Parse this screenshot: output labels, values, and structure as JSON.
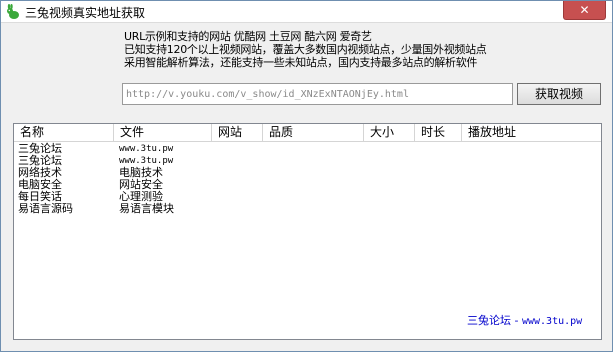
{
  "window": {
    "title": "三兔视频真实地址获取",
    "close_label": "✕",
    "app_icon": "rabbit-icon"
  },
  "intro": {
    "line1": "URL示例和支持的网站 优酷网 土豆网 酷六网 爱奇艺",
    "line2": "已知支持120个以上视频网站，覆盖大多数国内视频站点，少量国外视频站点",
    "line3": "采用智能解析算法，还能支持一些未知站点，国内支持最多站点的解析软件"
  },
  "url_input": {
    "placeholder": "http://v.youku.com/v_show/id_XNzExNTAONjEy.html",
    "value": ""
  },
  "fetch_button": {
    "label": "获取视频"
  },
  "list": {
    "columns": [
      "名称",
      "文件",
      "网站",
      "品质",
      "大小",
      "时长",
      "播放地址"
    ],
    "rows": [
      {
        "name": "三兔论坛",
        "file": "www.3tu.pw"
      },
      {
        "name": "三兔论坛",
        "file": "www.3tu.pw"
      },
      {
        "name": "网络技术",
        "file": "电脑技术"
      },
      {
        "name": "电脑安全",
        "file": "网站安全"
      },
      {
        "name": "每日笑话",
        "file": "心理测验"
      },
      {
        "name": "易语言源码",
        "file": "易语言模块"
      }
    ]
  },
  "footer": {
    "link_name": "三兔论坛",
    "link_sep": " - ",
    "link_url": "www.3tu.pw"
  },
  "colors": {
    "close_button": "#c75050",
    "footer_link": "#0000cc",
    "window_bg": "#f0f0f0"
  }
}
